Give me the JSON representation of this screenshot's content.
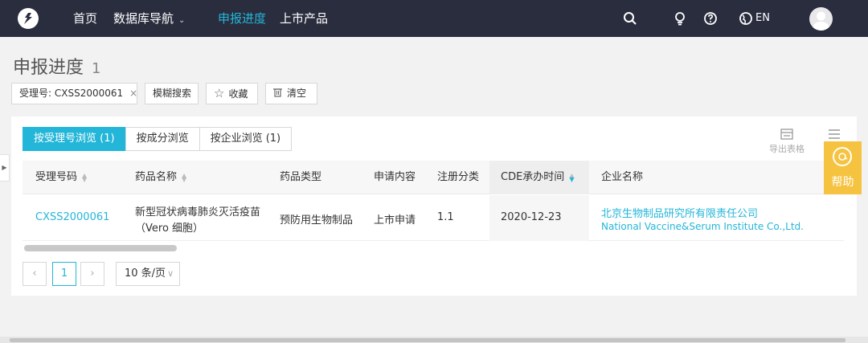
{
  "nav": {
    "items": [
      {
        "label": "首页",
        "active": false
      },
      {
        "label": "数据库导航",
        "active": false,
        "has_dropdown": true
      },
      {
        "label": "申报进度",
        "active": true
      },
      {
        "label": "上市产品",
        "active": false
      }
    ],
    "language": "EN",
    "icons": [
      "search-icon",
      "bulb-icon",
      "question-icon",
      "globe-icon",
      "user-avatar"
    ]
  },
  "page": {
    "title": "申报进度",
    "count": "1"
  },
  "filters": {
    "tag_label": "受理号: CXSS2000061",
    "fuzzy_search": "模糊搜索",
    "favorite": "收藏",
    "clear": "清空"
  },
  "tabs": [
    {
      "label": "按受理号浏览 (1)",
      "active": true
    },
    {
      "label": "按成分浏览",
      "active": false
    },
    {
      "label": "按企业浏览 (1)",
      "active": false
    }
  ],
  "toolbar": {
    "export": "导出表格",
    "more": "更"
  },
  "table": {
    "columns": [
      "受理号码",
      "药品名称",
      "药品类型",
      "申请内容",
      "注册分类",
      "CDE承办时间",
      "企业名称"
    ],
    "rows": [
      {
        "acceptance_no": "CXSS2000061",
        "drug_name_line1": "新型冠状病毒肺炎灭活疫苗",
        "drug_name_line2": "（Vero 细胞）",
        "drug_type": "预防用生物制品",
        "application": "上市申请",
        "reg_class": "1.1",
        "cde_date": "2020-12-23",
        "company_cn": "北京生物制品研究所有限责任公司",
        "company_en": "National Vaccine&Serum Institute Co.,Ltd."
      }
    ]
  },
  "pager": {
    "current": "1",
    "page_size": "10 条/页"
  },
  "help": {
    "label": "帮助"
  },
  "colors": {
    "nav_bg": "#2a2d3e",
    "accent": "#23b6d8",
    "help": "#f6c340"
  }
}
